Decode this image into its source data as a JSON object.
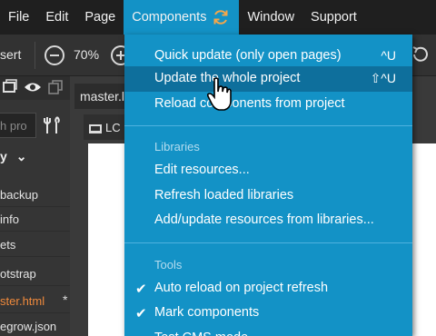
{
  "menubar": {
    "items": [
      "File",
      "Edit",
      "Page",
      "Components",
      "Window",
      "Support"
    ],
    "active_icon": "refresh-icon"
  },
  "toolbar": {
    "insert_label": "sert",
    "zoom": "70%"
  },
  "left_panel": {
    "search_placeholder": "h pro",
    "header": "y",
    "tree_items": [
      "backup",
      "info",
      "ets",
      "otstrap",
      "ster.html",
      "egrow.json"
    ],
    "modified_marker": "*"
  },
  "document": {
    "tab_label": "master.l",
    "subtab_label": "LC"
  },
  "dropdown": {
    "items_top": [
      {
        "label": "Quick update (only open pages)",
        "shortcut": "^U"
      },
      {
        "label": "Update the whole project",
        "shortcut": "⇧^U"
      },
      {
        "label": "Reload components from project",
        "shortcut": ""
      }
    ],
    "libraries_header": "Libraries",
    "items_libraries": [
      {
        "label": "Edit resources..."
      },
      {
        "label": "Refresh loaded libraries"
      },
      {
        "label": "Add/update resources from libraries..."
      }
    ],
    "tools_header": "Tools",
    "items_tools": [
      {
        "label": "Auto reload on project refresh",
        "checked": true
      },
      {
        "label": "Mark components",
        "checked": true
      },
      {
        "label": "Test CMS mode",
        "checked": false
      }
    ]
  },
  "colors": {
    "menu_blue": "#1392c6",
    "menu_hover": "#0e6f9c",
    "modified_orange": "#f08a3c"
  }
}
